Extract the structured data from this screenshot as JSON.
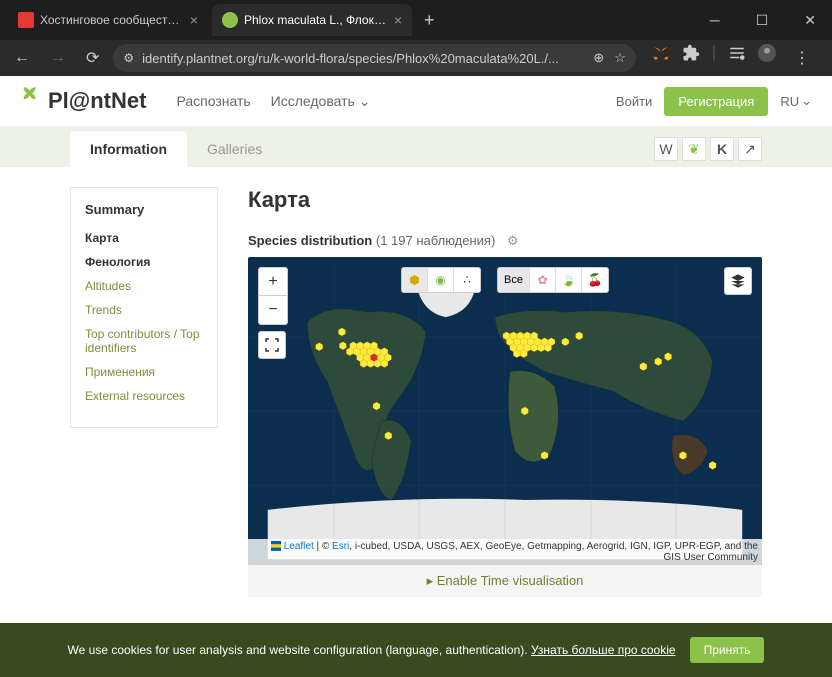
{
  "browser": {
    "tabs": [
      {
        "title": "Хостинговое сообщество «Tim",
        "active": false
      },
      {
        "title": "Phlox maculata L., Флокс пятни",
        "active": true
      }
    ],
    "url": "identify.plantnet.org/ru/k-world-flora/species/Phlox%20maculata%20L./..."
  },
  "header": {
    "logo": "Pl@ntNet",
    "nav": {
      "recognize": "Распознать",
      "explore": "Исследовать"
    },
    "login": "Войти",
    "register": "Регистрация",
    "lang": "RU"
  },
  "page_tabs": {
    "info": "Information",
    "galleries": "Galleries"
  },
  "sidebar": {
    "title": "Summary",
    "items": [
      {
        "label": "Карта",
        "active": true
      },
      {
        "label": "Фенология",
        "active": true
      },
      {
        "label": "Altitudes",
        "active": false
      },
      {
        "label": "Trends",
        "active": false
      },
      {
        "label": "Top contributors / Top identifiers",
        "active": false
      },
      {
        "label": "Применения",
        "active": false
      },
      {
        "label": "External resources",
        "active": false
      }
    ]
  },
  "main": {
    "title": "Карта",
    "dist_label": "Species distribution",
    "dist_count": "(1 197 наблюдения)",
    "map_filter_all": "Все",
    "attribution_leaflet": "Leaflet",
    "attribution_esri": "Esri",
    "attribution_rest": ", i-cubed, USDA, USGS, AEX, GeoEye, Getmapping, Aerogrid, IGN, IGP, UPR-EGP, and the GIS User Community",
    "time_btn": "▸  Enable Time visualisation"
  },
  "cookie": {
    "text": "We use cookies for user analysis and website configuration (language, authentication).",
    "link": "Узнать больше про cookie",
    "accept": "Принять"
  }
}
